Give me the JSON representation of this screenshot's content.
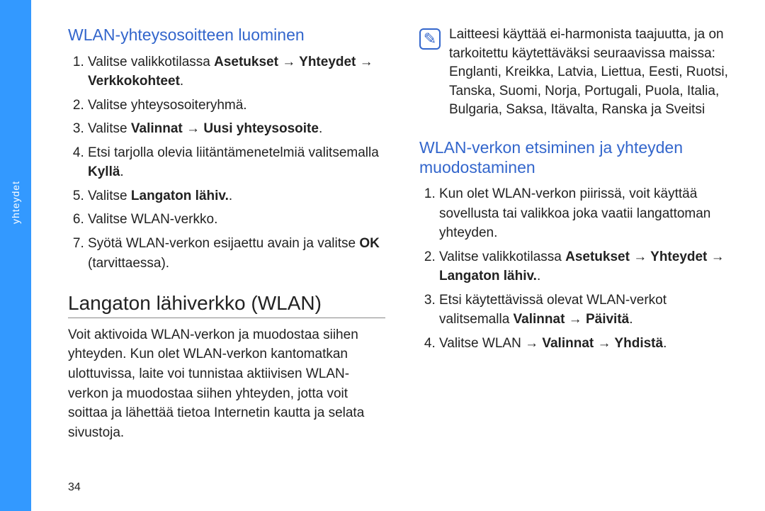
{
  "sideTab": "yhteydet",
  "pageNumber": "34",
  "left": {
    "heading1": "WLAN-yhteysosoitteen luominen",
    "list1": [
      {
        "pre": "Valitse valikkotilassa ",
        "bold": "Asetukset → Yhteydet → Verkkokohteet",
        "post": "."
      },
      {
        "pre": "Valitse yhteysosoiteryhmä.",
        "bold": "",
        "post": ""
      },
      {
        "pre": "Valitse ",
        "bold": "Valinnat → Uusi yhteysosoite",
        "post": "."
      },
      {
        "pre": "Etsi tarjolla olevia liitäntämenetelmiä valitsemalla ",
        "bold": "Kyllä",
        "post": "."
      },
      {
        "pre": "Valitse ",
        "bold": "Langaton lähiv.",
        "post": "."
      },
      {
        "pre": "Valitse WLAN-verkko.",
        "bold": "",
        "post": ""
      },
      {
        "pre": "Syötä WLAN-verkon esijaettu avain ja valitse ",
        "bold": "OK",
        "post": " (tarvittaessa)."
      }
    ],
    "heading2": "Langaton lähiverkko (WLAN)",
    "para": "Voit aktivoida WLAN-verkon ja muodostaa siihen yhteyden. Kun olet WLAN-verkon kantomatkan ulottuvissa, laite voi tunnistaa aktiivisen WLAN-verkon ja muodostaa siihen yhteyden, jotta voit soittaa ja lähettää tietoa Internetin kautta ja selata sivustoja."
  },
  "right": {
    "noteIconGlyph": "✎",
    "note": "Laitteesi käyttää ei-harmonista taajuutta, ja on tarkoitettu käytettäväksi seuraavissa maissa: Englanti, Kreikka, Latvia, Liettua, Eesti, Ruotsi, Tanska, Suomi, Norja, Portugali, Puola, Italia, Bulgaria, Saksa, Itävalta, Ranska ja Sveitsi",
    "heading": "WLAN-verkon etsiminen ja yhteyden muodostaminen",
    "list": [
      {
        "pre": "Kun olet WLAN-verkon piirissä, voit käyttää sovellusta tai valikkoa joka vaatii langattoman yhteyden.",
        "bold": "",
        "post": ""
      },
      {
        "pre": "Valitse valikkotilassa ",
        "bold": "Asetukset → Yhteydet → Langaton lähiv.",
        "post": "."
      },
      {
        "pre": "Etsi käytettävissä olevat WLAN-verkot valitsemalla ",
        "bold": "Valinnat → Päivitä",
        "post": "."
      },
      {
        "pre": "Valitse WLAN → ",
        "bold": "Valinnat → Yhdistä",
        "post": "."
      }
    ]
  }
}
